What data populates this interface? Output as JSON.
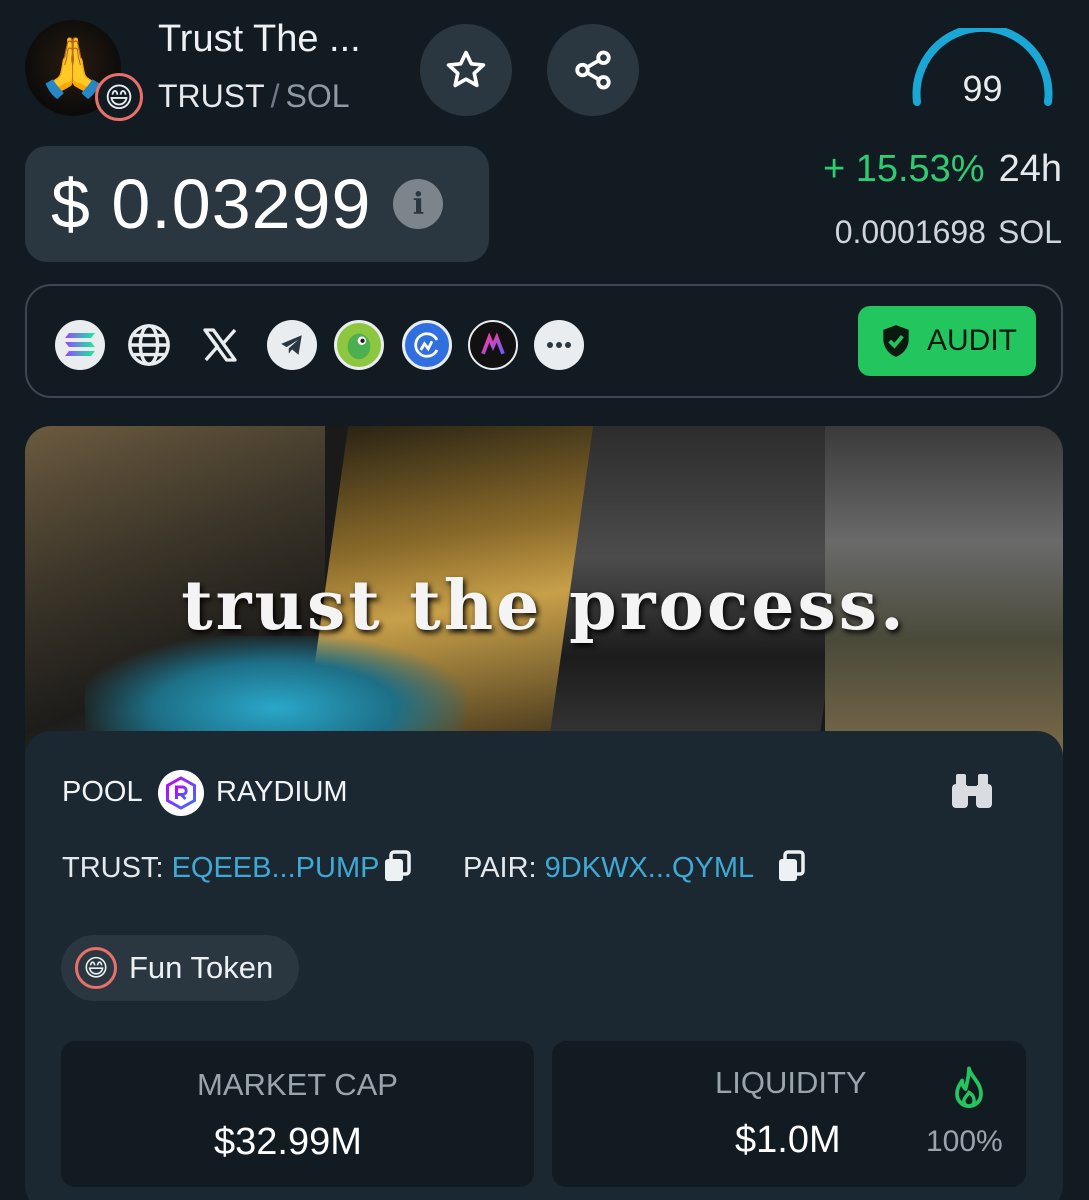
{
  "header": {
    "token_name": "Trust The ...",
    "symbol": "TRUST",
    "separator": "/",
    "quote": "SOL",
    "avatar_icon": "praying-hands-icon",
    "badge_icon": "grinning-face-icon",
    "score": "99"
  },
  "price": {
    "usd": "$ 0.03299",
    "change_pct": "+ 15.53%",
    "change_period": "24h",
    "sol_value": "0.0001698",
    "sol_unit": "SOL"
  },
  "links": [
    "solana-icon",
    "website-icon",
    "x-icon",
    "telegram-icon",
    "coingecko-icon",
    "coinmarketcap-icon",
    "dexscreener-icon",
    "more-icon"
  ],
  "audit": {
    "label": "AUDIT",
    "color": "#22c55e"
  },
  "banner": {
    "text": "trust the process."
  },
  "pool": {
    "label": "POOL",
    "dex": "RAYDIUM",
    "token_key": "TRUST:",
    "token_addr": "EQEEB...PUMP",
    "pair_key": "PAIR:",
    "pair_addr": "9DKWX...QYML",
    "badge": "Fun Token"
  },
  "stats": {
    "market_cap_label": "MARKET CAP",
    "market_cap_value": "$32.99M",
    "liquidity_label": "LIQUIDITY",
    "liquidity_value": "$1.0M",
    "liquidity_pct": "100%"
  },
  "colors": {
    "accent_green": "#2ecc71",
    "link_blue": "#3fa9d6",
    "score_arc": "#1aa7d6"
  }
}
